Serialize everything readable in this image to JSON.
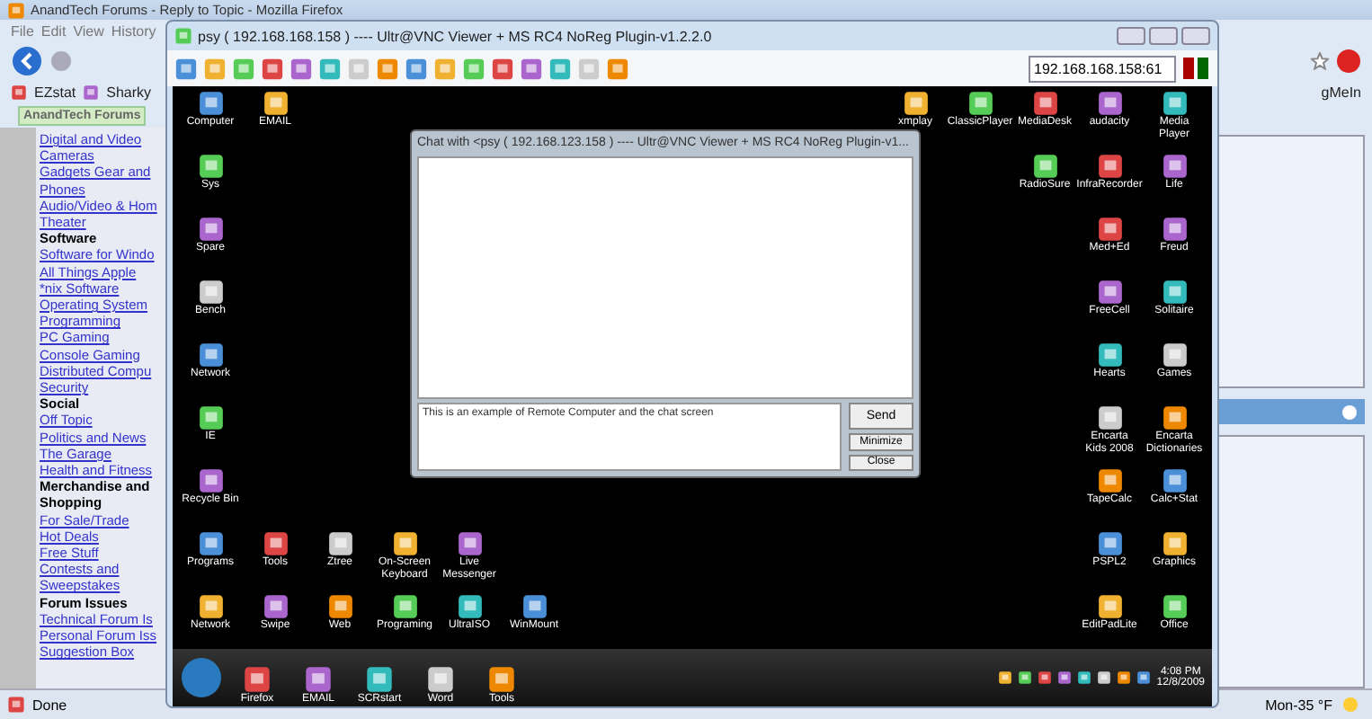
{
  "browser": {
    "title": "AnandTech Forums - Reply to Topic - Mozilla Firefox",
    "menu": [
      "File",
      "Edit",
      "View",
      "History"
    ],
    "bookmarks": [
      "EZstat",
      "Sharky"
    ],
    "tab": "AnandTech Forums",
    "right_tab": "gMeIn",
    "status": "Done",
    "weather": "Mon-35 °F",
    "sidebar": [
      {
        "kind": "link",
        "text": "Digital and Video Cameras"
      },
      {
        "kind": "link",
        "text": "Gadgets Gear and Phones"
      },
      {
        "kind": "link",
        "text": "Audio/Video & Hom Theater"
      },
      {
        "kind": "heading",
        "text": "Software"
      },
      {
        "kind": "link",
        "text": "Software for Windo"
      },
      {
        "kind": "link",
        "text": "All Things Apple"
      },
      {
        "kind": "link",
        "text": "*nix Software"
      },
      {
        "kind": "link",
        "text": "Operating System"
      },
      {
        "kind": "link",
        "text": "Programming"
      },
      {
        "kind": "link",
        "text": "PC Gaming"
      },
      {
        "kind": "link",
        "text": "Console Gaming"
      },
      {
        "kind": "link",
        "text": "Distributed Compu"
      },
      {
        "kind": "link",
        "text": "Security"
      },
      {
        "kind": "heading",
        "text": "Social"
      },
      {
        "kind": "link",
        "text": "Off Topic"
      },
      {
        "kind": "link",
        "text": "Politics and News"
      },
      {
        "kind": "link",
        "text": "The Garage"
      },
      {
        "kind": "link",
        "text": "Health and Fitness"
      },
      {
        "kind": "heading",
        "text": "Merchandise and Shopping"
      },
      {
        "kind": "link",
        "text": "For Sale/Trade"
      },
      {
        "kind": "link",
        "text": "Hot Deals"
      },
      {
        "kind": "link",
        "text": "Free Stuff"
      },
      {
        "kind": "link",
        "text": "Contests and Sweepstakes"
      },
      {
        "kind": "heading",
        "text": "Forum Issues"
      },
      {
        "kind": "link",
        "text": "Technical Forum Is"
      },
      {
        "kind": "link",
        "text": "Personal Forum Iss"
      },
      {
        "kind": "link",
        "text": "Suggestion Box"
      }
    ]
  },
  "vnc": {
    "title": "psy ( 192.168.168.158 ) ---- Ultr@VNC Viewer + MS RC4 NoReg Plugin-v1.2.2.0",
    "address": "192.168.168.158:61",
    "desktop": {
      "left_column": [
        [
          "Computer",
          "EMAIL"
        ],
        [
          "Sys"
        ],
        [
          "Spare"
        ],
        [
          "Bench"
        ],
        [
          "Network"
        ],
        [
          "IE"
        ],
        [
          "Recycle Bin"
        ]
      ],
      "bottom_rows": [
        [
          "Programs",
          "Tools",
          "Ztree",
          "On-Screen Keyboard",
          "Live Messenger"
        ],
        [
          "Network",
          "Swipe",
          "Web",
          "Programing",
          "UltraISO",
          "WinMount"
        ]
      ],
      "top_row": [
        "xmplay",
        "ClassicPlayer",
        "MediaDesk",
        "audacity",
        "Media Player"
      ],
      "right_grid": [
        [
          "RadioSure",
          "InfraRecorder",
          "Life"
        ],
        [
          "Med+Ed",
          "Freud"
        ],
        [
          "FreeCell",
          "Solitaire"
        ],
        [
          "Hearts",
          "Games"
        ],
        [
          "Encarta Kids 2008",
          "Encarta Dictionaries"
        ],
        [
          "TapeCalc",
          "Calc+Stat"
        ],
        [
          "PSPL2",
          "Graphics"
        ],
        [
          "EditPadLite",
          "Office"
        ]
      ]
    },
    "chat": {
      "title": "Chat with <psy ( 192.168.123.158 ) ---- Ultr@VNC Viewer + MS RC4 NoReg Plugin-v1...",
      "message": "This is an example of Remote Computer and the chat screen",
      "buttons": [
        "Send",
        "Minimize",
        "Close"
      ]
    },
    "taskbar": {
      "items": [
        "Firefox",
        "EMAIL",
        "SCRstart",
        "Word",
        "Tools"
      ],
      "time": "4:08 PM",
      "date": "12/8/2009"
    }
  }
}
